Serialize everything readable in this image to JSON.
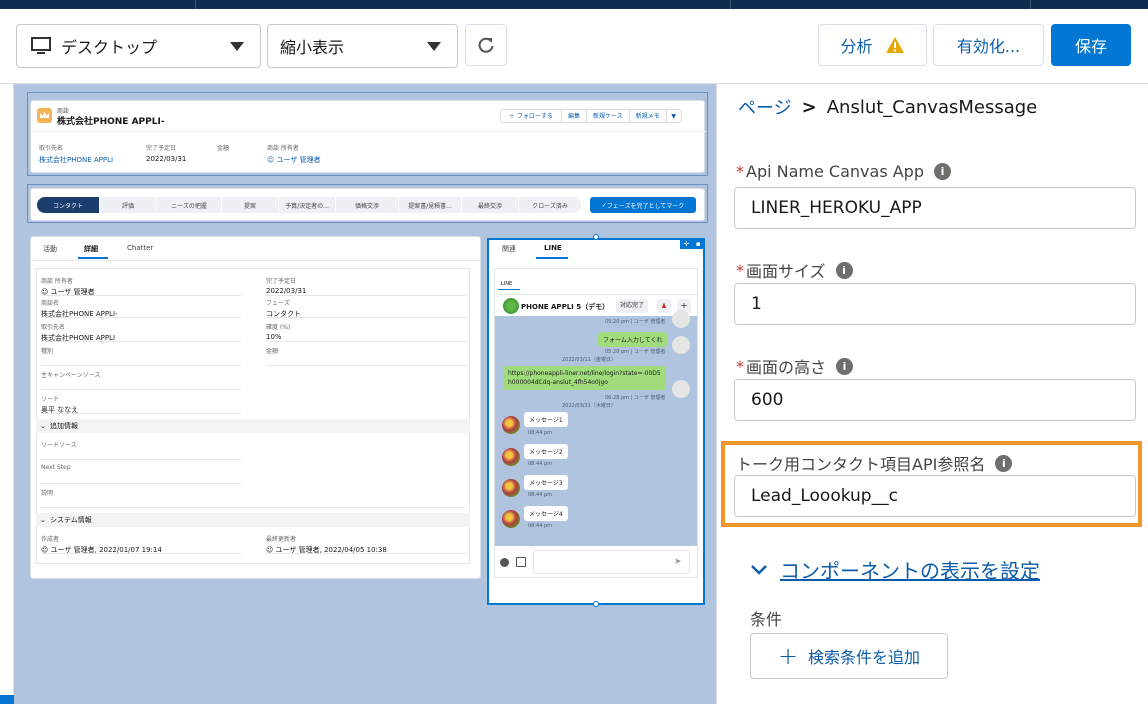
{
  "toolbar": {
    "device_select": "デスクトップ",
    "zoom_select": "縮小表示",
    "analyze_label": "分析",
    "activate_label": "有効化...",
    "save_label": "保存"
  },
  "record": {
    "object_type": "商談",
    "name": "株式会社PHONE APPLI-",
    "actions": [
      "フォローする",
      "編集",
      "新規ケース",
      "新規メモ"
    ],
    "highlights": [
      {
        "label": "取引先名",
        "value": "株式会社PHONE APPLI"
      },
      {
        "label": "完了予定日",
        "value": "2022/03/31"
      },
      {
        "label": "金額",
        "value": ""
      },
      {
        "label": "商談 所有者",
        "value": "ユーザ 管理者"
      }
    ]
  },
  "path": {
    "stages": [
      "コンタクト",
      "評価",
      "ニーズの把握",
      "提案",
      "予算/決定者の...",
      "価格交渉",
      "提案書/見積書...",
      "最終交渉",
      "クローズ済み"
    ],
    "complete_button": "フェーズを完了としてマーク"
  },
  "detail": {
    "tabs": [
      "活動",
      "詳細",
      "Chatter"
    ],
    "fields_left": [
      {
        "label": "商談 所有者",
        "value": "ユーザ 管理者"
      },
      {
        "label": "商談名",
        "value": "株式会社PHONE APPLI-"
      },
      {
        "label": "取引先名",
        "value": "株式会社PHONE APPLI"
      },
      {
        "label": "種別",
        "value": ""
      },
      {
        "label": "主キャンペーンソース",
        "value": ""
      },
      {
        "label": "リード",
        "value": "奥平 ななえ"
      }
    ],
    "fields_right": [
      {
        "label": "完了予定日",
        "value": "2022/03/31"
      },
      {
        "label": "フェーズ",
        "value": "コンタクト"
      },
      {
        "label": "確度 (%)",
        "value": "10%"
      },
      {
        "label": "金額",
        "value": ""
      }
    ],
    "section_additional": "追加情報",
    "additional_fields": [
      {
        "label": "リードソース",
        "value": ""
      },
      {
        "label": "Next Step",
        "value": ""
      },
      {
        "label": "説明",
        "value": ""
      }
    ],
    "section_system": "システム情報",
    "created_label": "作成者",
    "created_value": "ユーザ 管理者, 2022/01/07 19:14",
    "modified_label": "最終更新者",
    "modified_value": "ユーザ 管理者, 2022/04/05 10:38"
  },
  "line_panel": {
    "tabs": [
      "関連",
      "LINE"
    ],
    "subtab": "LINE",
    "account": "PHONE APPLI 5（デモ）",
    "done_button": "対応完了",
    "time1": "05:20 pm | ユーザ 管理者",
    "msg_form": "フォーム入力してくれ",
    "time2": "05:20 pm | ユーザ 管理者",
    "date1": "2022/03/11（金曜日）",
    "msg_link": "https://phoneappli-liner.net/line/login?state=-00D5h000004dCdq-anslut_4fh54o0jgo",
    "time3": "06:28 pm | ユーザ 管理者",
    "date2": "2022/03/31（木曜日）",
    "messages": [
      {
        "text": "メッセージ1",
        "time": "08:44 pm"
      },
      {
        "text": "メッセージ2",
        "time": "08:44 pm"
      },
      {
        "text": "メッセージ3",
        "time": "08:44 pm"
      },
      {
        "text": "メッセージ4",
        "time": "08:44 pm"
      }
    ]
  },
  "panel": {
    "breadcrumb_link": "ページ",
    "breadcrumb_sep": ">",
    "breadcrumb_current": "Anslut_CanvasMessage",
    "field1_label": "Api Name Canvas App",
    "field1_value": "LINER_HEROKU_APP",
    "field2_label": "画面サイズ",
    "field2_value": "1",
    "field3_label": "画面の高さ",
    "field3_value": "600",
    "field4_label": "トーク用コンタクト項目API参照名",
    "field4_value": "Lead_Loookup__c",
    "section_link": "コンポーネントの表示を設定",
    "conditions_label": "条件",
    "add_filter_label": "検索条件を追加"
  },
  "colors": {
    "brand": "#0176d3",
    "highlight": "#f0962c",
    "warning": "#e8a900"
  }
}
